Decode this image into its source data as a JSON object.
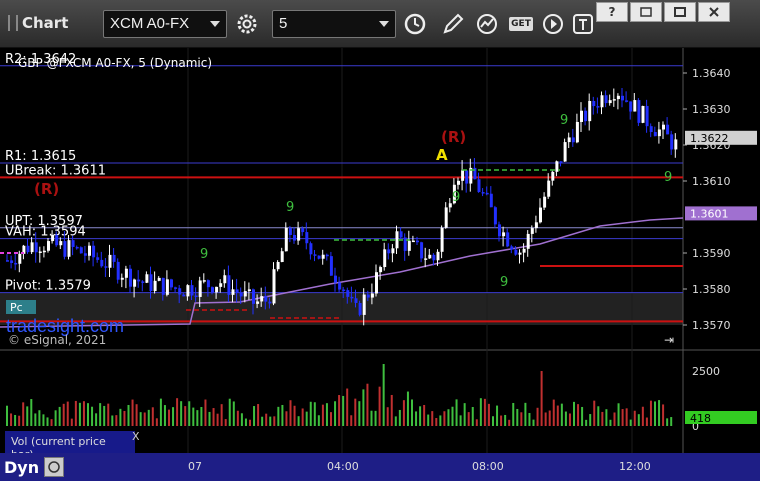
{
  "window": {
    "title": "Chart"
  },
  "toolbar": {
    "symbol": "XCM A0-FX",
    "interval": "5",
    "get_label": "GET"
  },
  "chart": {
    "header_label": "GBP @FXCM A0-FX, 5 (Dynamic)",
    "levels": [
      {
        "label": "R2: 1.3642",
        "value": 1.3642,
        "color": "#3b3bd0"
      },
      {
        "label": "R1: 1.3615",
        "value": 1.3615,
        "color": "#3b3bd0"
      },
      {
        "label": "UBreak: 1.3611",
        "value": 1.3611,
        "color": "#cc1111"
      },
      {
        "label": "UPT: 1.3597",
        "value": 1.3597,
        "color": "#8a8ad0"
      },
      {
        "label": "VAH: 1.3594",
        "value": 1.3594,
        "color": "#3b3bd0"
      },
      {
        "label": "Pivot: 1.3579",
        "value": 1.3579,
        "color": "#3b3bd0"
      }
    ],
    "price_ticks": [
      "1.3640",
      "1.3630",
      "1.3620",
      "1.3610",
      "1.3590",
      "1.3580",
      "1.3570"
    ],
    "last_price": "1.3622",
    "ma_value": "1.3601",
    "markers": {
      "r_left": "(R)",
      "r_mid": "(R)",
      "a_mark": "A",
      "nine": "9",
      "pc": "Pc"
    },
    "watermark": "tradesight.com",
    "copyright": "© eSignal, 2021",
    "volume": {
      "label": "Vol (current price bar)",
      "ticks": [
        "2500",
        "0"
      ],
      "last": "418",
      "close_icon": "X"
    },
    "time_ticks": [
      "07",
      "04:00",
      "08:00",
      "12:00"
    ],
    "dyn_label": "Dyn"
  },
  "colors": {
    "up_bar": "#ffffff",
    "down_bar": "#2230ff",
    "ma": "#a070d0",
    "vol_up": "#3fbf3f",
    "vol_down": "#c03030"
  }
}
